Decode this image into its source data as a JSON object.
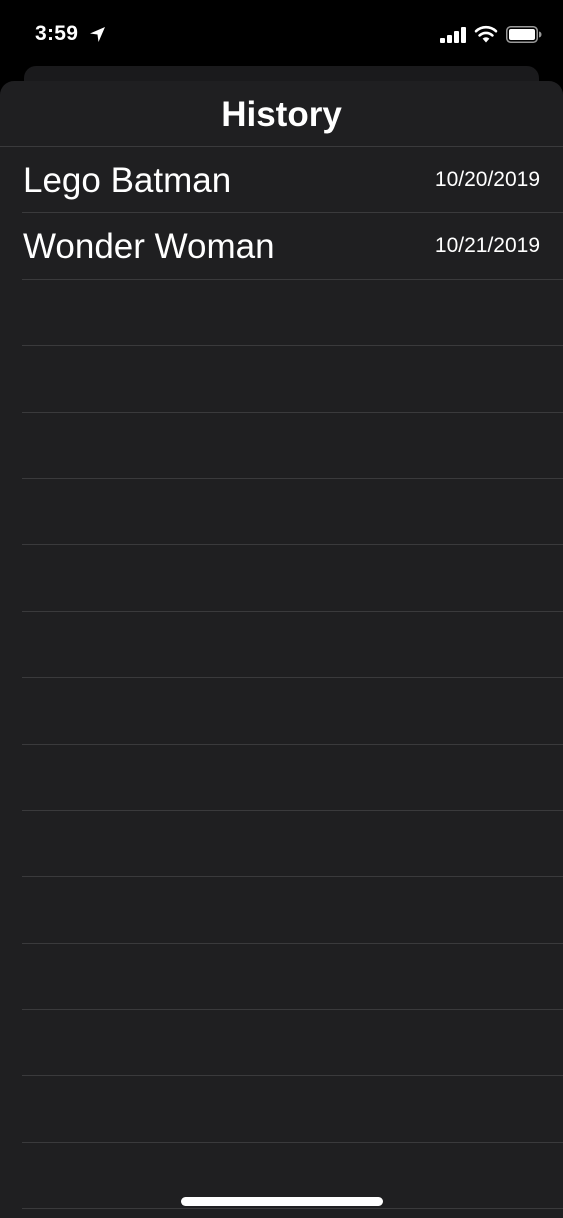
{
  "status_bar": {
    "time": "3:59",
    "icons": [
      "location-arrow-icon",
      "cellular-signal-icon",
      "wifi-icon",
      "battery-icon"
    ]
  },
  "sheet": {
    "title": "History",
    "items": [
      {
        "title": "Lego Batman",
        "date": "10/20/2019"
      },
      {
        "title": "Wonder Woman",
        "date": "10/21/2019"
      },
      {
        "title": "",
        "date": ""
      },
      {
        "title": "",
        "date": ""
      },
      {
        "title": "",
        "date": ""
      },
      {
        "title": "",
        "date": ""
      },
      {
        "title": "",
        "date": ""
      },
      {
        "title": "",
        "date": ""
      },
      {
        "title": "",
        "date": ""
      },
      {
        "title": "",
        "date": ""
      },
      {
        "title": "",
        "date": ""
      },
      {
        "title": "",
        "date": ""
      },
      {
        "title": "",
        "date": ""
      },
      {
        "title": "",
        "date": ""
      },
      {
        "title": "",
        "date": ""
      },
      {
        "title": "",
        "date": ""
      }
    ]
  },
  "colors": {
    "background": "#000000",
    "sheet": "#1f1f21",
    "separator": "#3a3a3c",
    "text": "#ffffff"
  }
}
